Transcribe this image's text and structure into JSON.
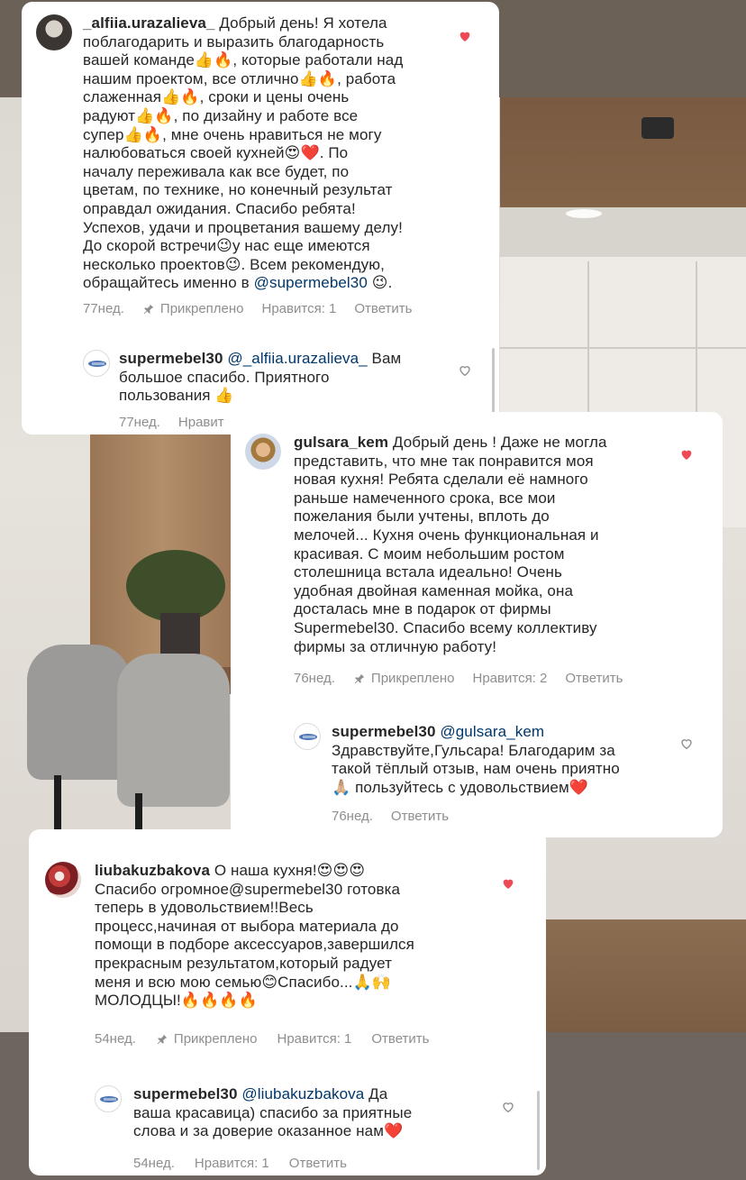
{
  "comments": [
    {
      "username": "_alfiia.urazalieva_",
      "text": " Добрый день! Я хотела\nпоблагодарить и выразить благодарность\nвашей команде👍🔥, которые работали над\nнашим проектом, все отлично👍🔥, работа\nслаженная👍🔥, сроки и цены очень\nрадуют👍🔥, по дизайну и работе все\nсупер👍🔥, мне очень нравиться не могу\nналюбоваться своей кухней😍❤️. По\nначалу переживала как все будет, по\nцветам, по технике, но конечный результат\nоправдал ожидания.  Спасибо ребята!\nУспехов, удачи и процветания вашему делу!\nДо скорой встречи😉у нас еще имеются\nнесколько проектов😉. Всем рекомендую,\nобращайтесь именно в ",
      "mention": "@supermebel30",
      "text_tail": " 😉.",
      "time": "77нед.",
      "pinned": "Прикреплено",
      "likes": "Нравится: 1",
      "reply_label": "Ответить",
      "liked": true,
      "reply": {
        "username": "supermebel30",
        "mention": "@_alfiia.urazalieva_",
        "text": " Вам\nбольшое спасибо. Приятного\nпользования 👍",
        "time": "77нед.",
        "likes": "Нравит"
      }
    },
    {
      "username": "gulsara_kem",
      "text": " Добрый день ! Даже не могла\nпредставить, что мне так понравится моя\nновая кухня! Ребята сделали её намного\nраньше намеченного срока, все мои\nпожелания были учтены, вплоть до\nмелочей... Кухня очень функциональная и\nкрасивая. С моим небольшим ростом\nстолешница встала идеально! Очень\nудобная двойная каменная мойка, она\nдосталась мне в подарок от фирмы\nSupermebel30. Спасибо всему коллективу\nфирмы за отличную работу!",
      "time": "76нед.",
      "pinned": "Прикреплено",
      "likes": "Нравится: 2",
      "reply_label": "Ответить",
      "liked": true,
      "reply": {
        "username": "supermebel30",
        "mention": "@gulsara_kem",
        "text": "\nЗдравствуйте,Гульсара! Благодарим за\nтакой тёплый отзыв, нам очень приятно\n🙏🏼 пользуйтесь с удовольствием❤️",
        "time": "76нед.",
        "reply_label": "Ответить"
      }
    },
    {
      "username": "liubakuzbakova",
      "text": " О наша кухня!😍😍😍\nСпасибо огромное@supermebel30 готовка\nтеперь в удовольствием!!Весь\nпроцесс,начиная от выбора материала до\nпомощи в подборе аксессуаров,завершился\nпрекрасным результатом,который радует\nменя и всю мою семью😊Спасибо...🙏🙌\nМОЛОДЦЫ!🔥🔥🔥🔥",
      "time": "54нед.",
      "pinned": "Прикреплено",
      "likes": "Нравится: 1",
      "reply_label": "Ответить",
      "liked": true,
      "reply": {
        "username": "supermebel30",
        "mention": "@liubakuzbakova",
        "text": " Да\nваша красавица) спасибо за приятные\nслова и за доверие оказанное нам❤️",
        "time": "54нед.",
        "likes": "Нравится: 1",
        "reply_label": "Ответить"
      }
    }
  ],
  "icons": {
    "heart_filled_color": "#ed4956",
    "heart_outline_color": "#8e8e8e",
    "pin": "pin-icon"
  }
}
